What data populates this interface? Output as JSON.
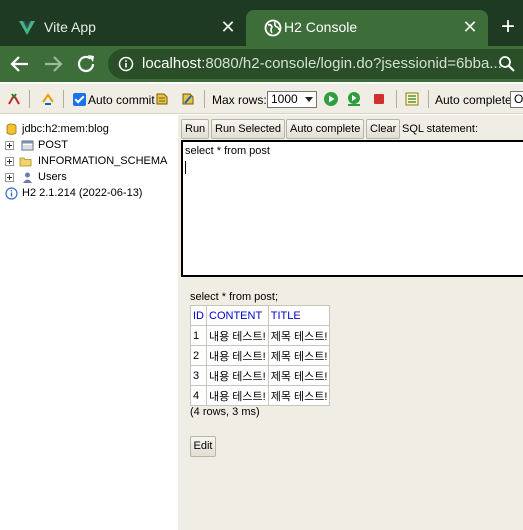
{
  "browser": {
    "tabs": [
      {
        "title": "Vite App",
        "active": false
      },
      {
        "title": "H2 Console",
        "active": true
      }
    ],
    "close_glyph": "✕",
    "new_tab_glyph": "+",
    "url_host": "localhost",
    "url_rest": ":8080/h2-console/login.do?jsessionid=6bba...",
    "colors": {
      "tabbar": "#1f3a22",
      "active_tab": "#3d6e3a"
    }
  },
  "toolbar": {
    "auto_commit_label": "Auto commit",
    "auto_commit_checked": true,
    "max_rows_label": "Max rows:",
    "max_rows_value": "1000",
    "auto_complete_label": "Auto complete",
    "auto_complete_value": "O"
  },
  "tree": {
    "connection": "jdbc:h2:mem:blog",
    "items": [
      {
        "label": "POST",
        "icon": "table-icon"
      },
      {
        "label": "INFORMATION_SCHEMA",
        "icon": "folder-icon"
      },
      {
        "label": "Users",
        "icon": "users-icon"
      }
    ],
    "version": "H2 2.1.214 (2022-06-13)"
  },
  "editor": {
    "buttons": {
      "run": "Run",
      "run_selected": "Run Selected",
      "auto_complete": "Auto complete",
      "clear": "Clear"
    },
    "sql_label": "SQL statement:",
    "sql_text": "select * from post"
  },
  "result": {
    "query": "select * from post;",
    "columns": [
      "ID",
      "CONTENT",
      "TITLE"
    ],
    "rows": [
      [
        "1",
        "내용 테스트!",
        "제목 테스트!"
      ],
      [
        "2",
        "내용 테스트!",
        "제목 테스트!"
      ],
      [
        "3",
        "내용 테스트!",
        "제목 테스트!"
      ],
      [
        "4",
        "내용 테스트!",
        "제목 테스트!"
      ]
    ],
    "row_count": "(4 rows, 3 ms)",
    "edit_label": "Edit"
  }
}
